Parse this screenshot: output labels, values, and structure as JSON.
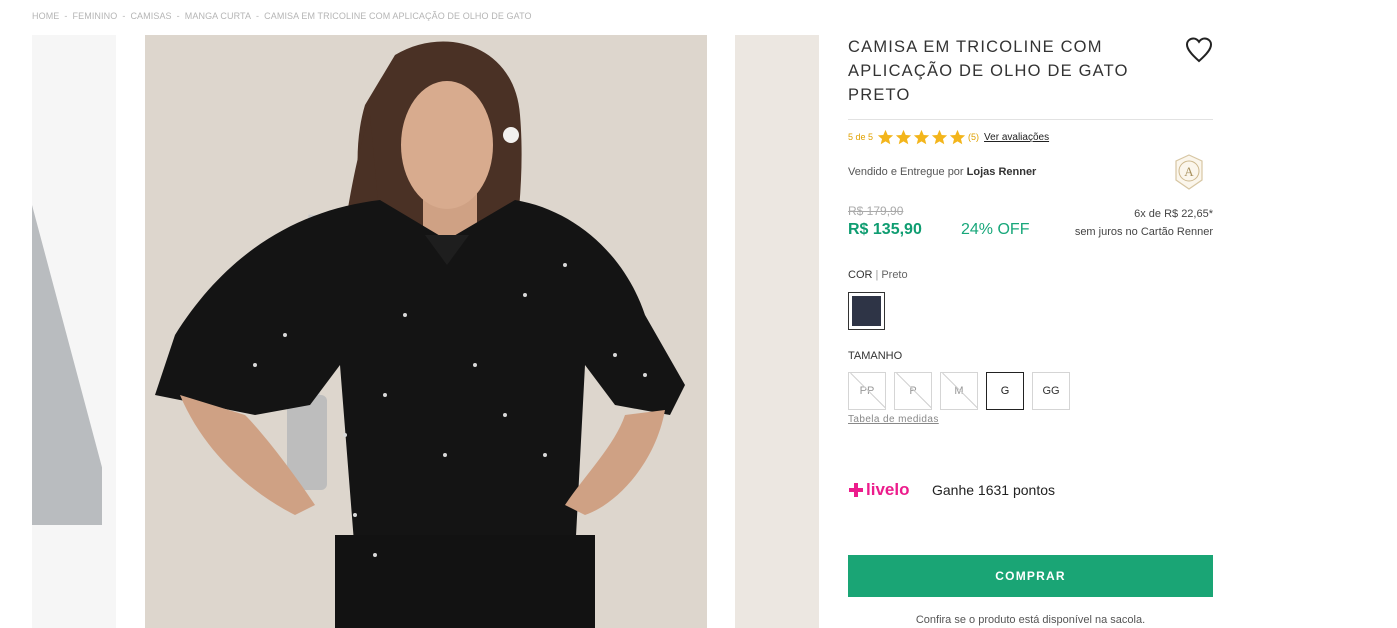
{
  "breadcrumb": [
    "HOME",
    "FEMININO",
    "CAMISAS",
    "MANGA CURTA",
    "CAMISA EM TRICOLINE COM APLICAÇÃO DE OLHO DE GATO"
  ],
  "breadcrumb_separator": "-",
  "product": {
    "title": "CAMISA EM TRICOLINE COM APLICAÇÃO DE OLHO DE GATO PRETO",
    "rating_score": "5 de 5",
    "rating_stars": 5,
    "rating_count": "(5)",
    "ratings_link": "Ver avaliações",
    "seller_prefix": "Vendido e Entregue por",
    "seller_name": "Lojas Renner",
    "seller_badge_letter": "A",
    "old_price": "R$ 179,90",
    "price": "R$ 135,90",
    "discount": "24% OFF",
    "installments_line1": "6x de R$ 22,65*",
    "installments_line2": "sem juros no Cartão Renner"
  },
  "color": {
    "label": "COR",
    "selected": "Preto",
    "swatch_hex": "#2e3446"
  },
  "size": {
    "label": "TAMANHO",
    "options": [
      {
        "label": "PP",
        "available": false
      },
      {
        "label": "P",
        "available": false
      },
      {
        "label": "M",
        "available": false
      },
      {
        "label": "G",
        "available": true,
        "selected": true
      },
      {
        "label": "GG",
        "available": true
      }
    ],
    "table_link": "Tabela de medidas"
  },
  "livelo": {
    "brand": "livelo",
    "points_text": "Ganhe 1631 pontos"
  },
  "buy_button": "COMPRAR",
  "bag_note": "Confira se o produto está disponível na sacola.",
  "colors": {
    "accent_green": "#1aa575",
    "price_green": "#0f9d71",
    "star": "#f3b51b",
    "livelo_pink": "#ec1c8c"
  },
  "icons": {
    "wishlist": "heart-icon",
    "star": "star-icon",
    "seller": "renner-badge-icon",
    "livelo": "livelo-plus-icon"
  }
}
